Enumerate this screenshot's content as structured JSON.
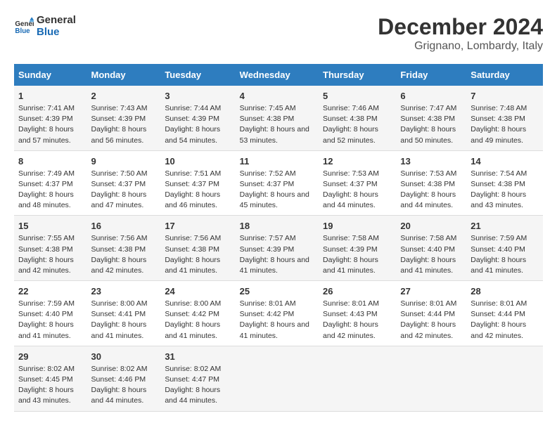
{
  "logo": {
    "line1": "General",
    "line2": "Blue"
  },
  "title": "December 2024",
  "subtitle": "Grignano, Lombardy, Italy",
  "weekdays": [
    "Sunday",
    "Monday",
    "Tuesday",
    "Wednesday",
    "Thursday",
    "Friday",
    "Saturday"
  ],
  "weeks": [
    [
      {
        "day": "1",
        "sunrise": "7:41 AM",
        "sunset": "4:39 PM",
        "daylight": "8 hours and 57 minutes."
      },
      {
        "day": "2",
        "sunrise": "7:43 AM",
        "sunset": "4:39 PM",
        "daylight": "8 hours and 56 minutes."
      },
      {
        "day": "3",
        "sunrise": "7:44 AM",
        "sunset": "4:39 PM",
        "daylight": "8 hours and 54 minutes."
      },
      {
        "day": "4",
        "sunrise": "7:45 AM",
        "sunset": "4:38 PM",
        "daylight": "8 hours and 53 minutes."
      },
      {
        "day": "5",
        "sunrise": "7:46 AM",
        "sunset": "4:38 PM",
        "daylight": "8 hours and 52 minutes."
      },
      {
        "day": "6",
        "sunrise": "7:47 AM",
        "sunset": "4:38 PM",
        "daylight": "8 hours and 50 minutes."
      },
      {
        "day": "7",
        "sunrise": "7:48 AM",
        "sunset": "4:38 PM",
        "daylight": "8 hours and 49 minutes."
      }
    ],
    [
      {
        "day": "8",
        "sunrise": "7:49 AM",
        "sunset": "4:37 PM",
        "daylight": "8 hours and 48 minutes."
      },
      {
        "day": "9",
        "sunrise": "7:50 AM",
        "sunset": "4:37 PM",
        "daylight": "8 hours and 47 minutes."
      },
      {
        "day": "10",
        "sunrise": "7:51 AM",
        "sunset": "4:37 PM",
        "daylight": "8 hours and 46 minutes."
      },
      {
        "day": "11",
        "sunrise": "7:52 AM",
        "sunset": "4:37 PM",
        "daylight": "8 hours and 45 minutes."
      },
      {
        "day": "12",
        "sunrise": "7:53 AM",
        "sunset": "4:37 PM",
        "daylight": "8 hours and 44 minutes."
      },
      {
        "day": "13",
        "sunrise": "7:53 AM",
        "sunset": "4:38 PM",
        "daylight": "8 hours and 44 minutes."
      },
      {
        "day": "14",
        "sunrise": "7:54 AM",
        "sunset": "4:38 PM",
        "daylight": "8 hours and 43 minutes."
      }
    ],
    [
      {
        "day": "15",
        "sunrise": "7:55 AM",
        "sunset": "4:38 PM",
        "daylight": "8 hours and 42 minutes."
      },
      {
        "day": "16",
        "sunrise": "7:56 AM",
        "sunset": "4:38 PM",
        "daylight": "8 hours and 42 minutes."
      },
      {
        "day": "17",
        "sunrise": "7:56 AM",
        "sunset": "4:38 PM",
        "daylight": "8 hours and 41 minutes."
      },
      {
        "day": "18",
        "sunrise": "7:57 AM",
        "sunset": "4:39 PM",
        "daylight": "8 hours and 41 minutes."
      },
      {
        "day": "19",
        "sunrise": "7:58 AM",
        "sunset": "4:39 PM",
        "daylight": "8 hours and 41 minutes."
      },
      {
        "day": "20",
        "sunrise": "7:58 AM",
        "sunset": "4:40 PM",
        "daylight": "8 hours and 41 minutes."
      },
      {
        "day": "21",
        "sunrise": "7:59 AM",
        "sunset": "4:40 PM",
        "daylight": "8 hours and 41 minutes."
      }
    ],
    [
      {
        "day": "22",
        "sunrise": "7:59 AM",
        "sunset": "4:40 PM",
        "daylight": "8 hours and 41 minutes."
      },
      {
        "day": "23",
        "sunrise": "8:00 AM",
        "sunset": "4:41 PM",
        "daylight": "8 hours and 41 minutes."
      },
      {
        "day": "24",
        "sunrise": "8:00 AM",
        "sunset": "4:42 PM",
        "daylight": "8 hours and 41 minutes."
      },
      {
        "day": "25",
        "sunrise": "8:01 AM",
        "sunset": "4:42 PM",
        "daylight": "8 hours and 41 minutes."
      },
      {
        "day": "26",
        "sunrise": "8:01 AM",
        "sunset": "4:43 PM",
        "daylight": "8 hours and 42 minutes."
      },
      {
        "day": "27",
        "sunrise": "8:01 AM",
        "sunset": "4:44 PM",
        "daylight": "8 hours and 42 minutes."
      },
      {
        "day": "28",
        "sunrise": "8:01 AM",
        "sunset": "4:44 PM",
        "daylight": "8 hours and 42 minutes."
      }
    ],
    [
      {
        "day": "29",
        "sunrise": "8:02 AM",
        "sunset": "4:45 PM",
        "daylight": "8 hours and 43 minutes."
      },
      {
        "day": "30",
        "sunrise": "8:02 AM",
        "sunset": "4:46 PM",
        "daylight": "8 hours and 44 minutes."
      },
      {
        "day": "31",
        "sunrise": "8:02 AM",
        "sunset": "4:47 PM",
        "daylight": "8 hours and 44 minutes."
      },
      null,
      null,
      null,
      null
    ]
  ],
  "labels": {
    "sunrise": "Sunrise:",
    "sunset": "Sunset:",
    "daylight": "Daylight:"
  }
}
